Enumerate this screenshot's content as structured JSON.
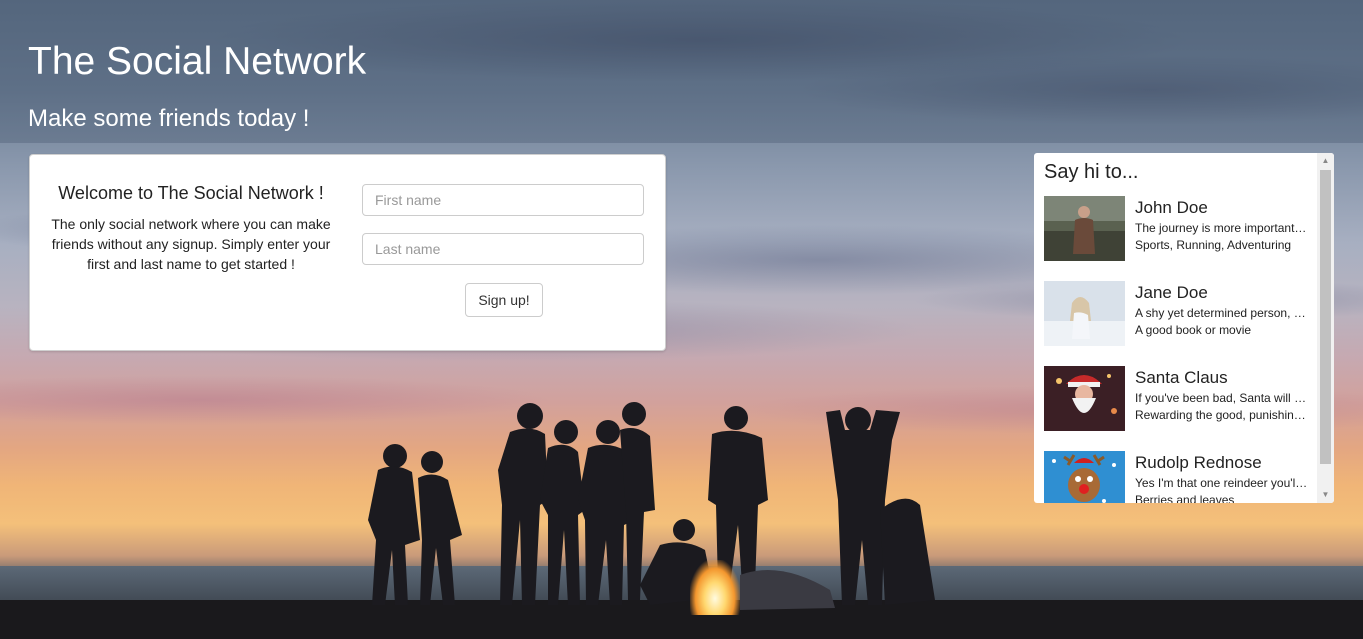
{
  "header": {
    "title": "The Social Network",
    "subtitle": "Make some friends today !"
  },
  "signup": {
    "welcome_title": "Welcome to The Social Network !",
    "welcome_text": "The only social network where you can make friends without any signup. Simply enter your first and last name to get started !",
    "first_name_placeholder": "First name",
    "last_name_placeholder": "Last name",
    "button_label": "Sign up!"
  },
  "friends": {
    "title": "Say hi to...",
    "items": [
      {
        "name": "John Doe",
        "bio": "The journey is more important than the destination",
        "interests": "Sports, Running, Adventuring",
        "photo_color": "#4d5443"
      },
      {
        "name": "Jane Doe",
        "bio": "A shy yet determined person, who loves winter",
        "interests": "A good book or movie",
        "photo_color": "#c9d3e0"
      },
      {
        "name": "Santa Claus",
        "bio": "If you've been bad, Santa will know",
        "interests": "Rewarding the good, punishing the bad",
        "photo_color": "#6b2a1f"
      },
      {
        "name": "Rudolp Rednose",
        "bio": "Yes I'm that one reindeer you'll never forget",
        "interests": "Berries and leaves",
        "photo_color": "#2e8fd0"
      }
    ]
  }
}
